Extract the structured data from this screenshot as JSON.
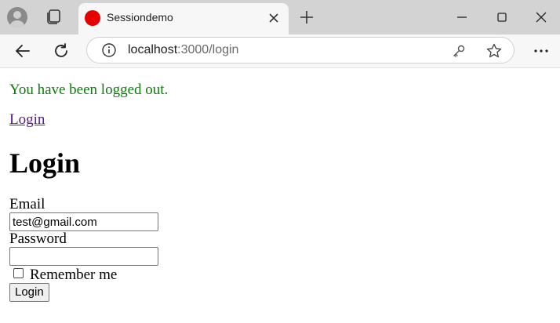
{
  "browser": {
    "tab_title": "Sessiondemo",
    "url_host": "localhost",
    "url_rest": ":3000/login",
    "favicon_color": "#e60000",
    "icons": [
      "profile-icon",
      "tab-actions-icon",
      "close-icon",
      "plus-icon",
      "minimize-icon",
      "maximize-icon",
      "close-icon",
      "back-arrow-icon",
      "reload-icon",
      "info-icon",
      "key-icon",
      "star-icon",
      "more-icon"
    ]
  },
  "page": {
    "notice": "You have been logged out.",
    "notice_color": "#0a7d0a",
    "login_link": "Login",
    "heading": "Login",
    "form": {
      "email_label": "Email",
      "email_value": "test@gmail.com",
      "password_label": "Password",
      "password_value": "",
      "remember_label": "Remember me",
      "remember_checked": false,
      "submit_label": "Login"
    }
  }
}
